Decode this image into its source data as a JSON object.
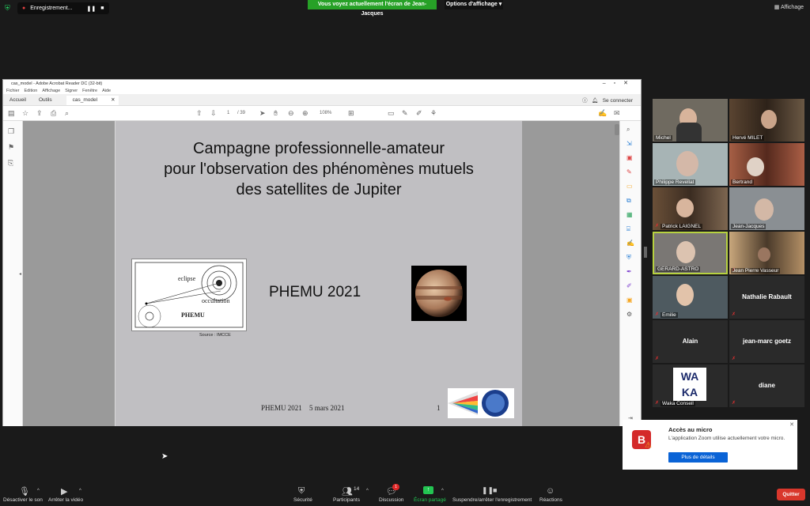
{
  "topbar": {
    "recording_label": "Enregistrement...",
    "share_banner": "Vous voyez actuellement l'écran de Jean-Jacques",
    "view_options": "Options d'affichage",
    "display_label": "Affichage"
  },
  "acrobat": {
    "window_title": "cas_model - Adobe Acrobat Reader DC (32-bit)",
    "menu": [
      "Fichier",
      "Edition",
      "Affichage",
      "Signer",
      "Fenêtre",
      "Aide"
    ],
    "tabs": {
      "home": "Accueil",
      "tools": "Outils",
      "document": "cas_model"
    },
    "connect": "Se connecter",
    "page_current": "1",
    "page_total": "/ 39",
    "zoom": "108%"
  },
  "slide": {
    "title_line1": "Campagne professionnelle-amateur",
    "title_line2": "pour l'observation des phénomènes mutuels",
    "title_line3": "des satellites de Jupiter",
    "center": "PHEMU 2021",
    "diagram_eclipse": "eclipse",
    "diagram_occultation": "occultation",
    "diagram_phemu": "PHEMU",
    "source": "Source : IMCCE",
    "footer_left": "PHEMU 2021",
    "footer_date": "5 mars 2021",
    "footer_page": "1",
    "logo_text": "WAKA"
  },
  "participants": [
    {
      "name": "Michel"
    },
    {
      "name": "Hervé MILET"
    },
    {
      "name": "Philippe Revellat"
    },
    {
      "name": "Bertrand"
    },
    {
      "name": "Patrick LAIGNEL"
    },
    {
      "name": "Jean-Jacques"
    },
    {
      "name": "GERARD-ASTRO"
    },
    {
      "name": "Jean Pierre Vasseur"
    },
    {
      "name": "Emilie"
    },
    {
      "name": "Nathalie Rabault"
    },
    {
      "name": "Alain"
    },
    {
      "name": "jean-marc goetz"
    },
    {
      "name": "Waka Conseil"
    },
    {
      "name": "diane"
    }
  ],
  "notification": {
    "title": "Accès au micro",
    "message": "L'application Zoom utilise actuellement votre micro.",
    "button": "Plus de détails"
  },
  "toolbar": {
    "mute": "Désactiver le son",
    "video": "Arrêter la vidéo",
    "security": "Sécurité",
    "participants": "Participants",
    "participants_count": "14",
    "discussion": "Discussion",
    "discussion_badge": "1",
    "share": "Écran partagé",
    "recording": "Suspendre/arrêter l'enregistrement",
    "reactions": "Réactions",
    "quit": "Quitter"
  }
}
